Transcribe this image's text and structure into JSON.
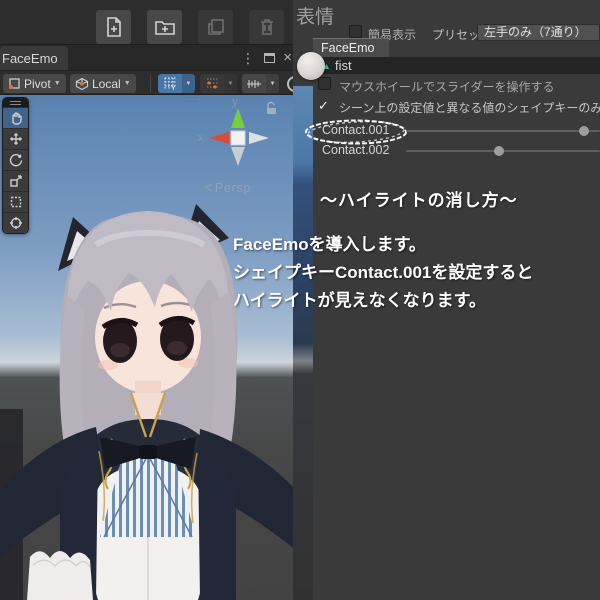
{
  "colors": {
    "panel_bg": "#3a3a3a",
    "toolbar_bg": "#2d2d2d",
    "selected_blue": "#4878a8",
    "sky_top": "#5a82b0",
    "accent_teal": "#3dbd9e",
    "snap_orange": "#e0702e",
    "annotation_text": "#ffffff"
  },
  "icons": {
    "menu_dots": "⋮",
    "close": "×",
    "dropdown_caret": "▼",
    "item_triangle": "▲",
    "check": "✓",
    "persp_arrow": "<"
  },
  "main_toolbar": {
    "buttons": [
      {
        "name": "new-asset",
        "enabled": true
      },
      {
        "name": "new-folder",
        "enabled": true
      },
      {
        "name": "duplicate",
        "enabled": false
      },
      {
        "name": "delete",
        "enabled": false
      }
    ]
  },
  "left_window": {
    "tab_label": "FaceEmo",
    "toolbar": {
      "pivot_label": "Pivot",
      "local_label": "Local",
      "grid_axis_label": "Y"
    },
    "scene": {
      "persp_label": "Persp",
      "gizmo": {
        "x_label": "x",
        "y_label": "y"
      }
    }
  },
  "right_panel": {
    "title": "表情",
    "simple_display_label": "簡易表示",
    "preset_label": "プリセット",
    "preset_value": "左手のみ（7通り）",
    "faceemo_tab_label": "FaceEmo",
    "selected_item_label": "fist",
    "checkbox_mousewheel": {
      "label": "マウスホイールでスライダーを操作する",
      "checked": false
    },
    "checkbox_scene_diff": {
      "label": "シーン上の設定値と異なる値のシェイプキーのみ表示",
      "checked": true
    },
    "sliders": [
      {
        "name": "Contact.001",
        "percent": 92,
        "circled": true
      },
      {
        "name": "Contact.002",
        "percent": 48,
        "circled": false
      }
    ]
  },
  "annotation": {
    "title": "〜ハイライトの消し方〜",
    "lines": [
      {
        "pre": "",
        "bold": "FaceEmo",
        "post": "を導入します。"
      },
      {
        "pre": "シェイプキー",
        "bold": "Contact.001",
        "post": "を設定すると"
      },
      {
        "pre": "ハイライトが見えなくなります。",
        "bold": "",
        "post": ""
      }
    ]
  }
}
